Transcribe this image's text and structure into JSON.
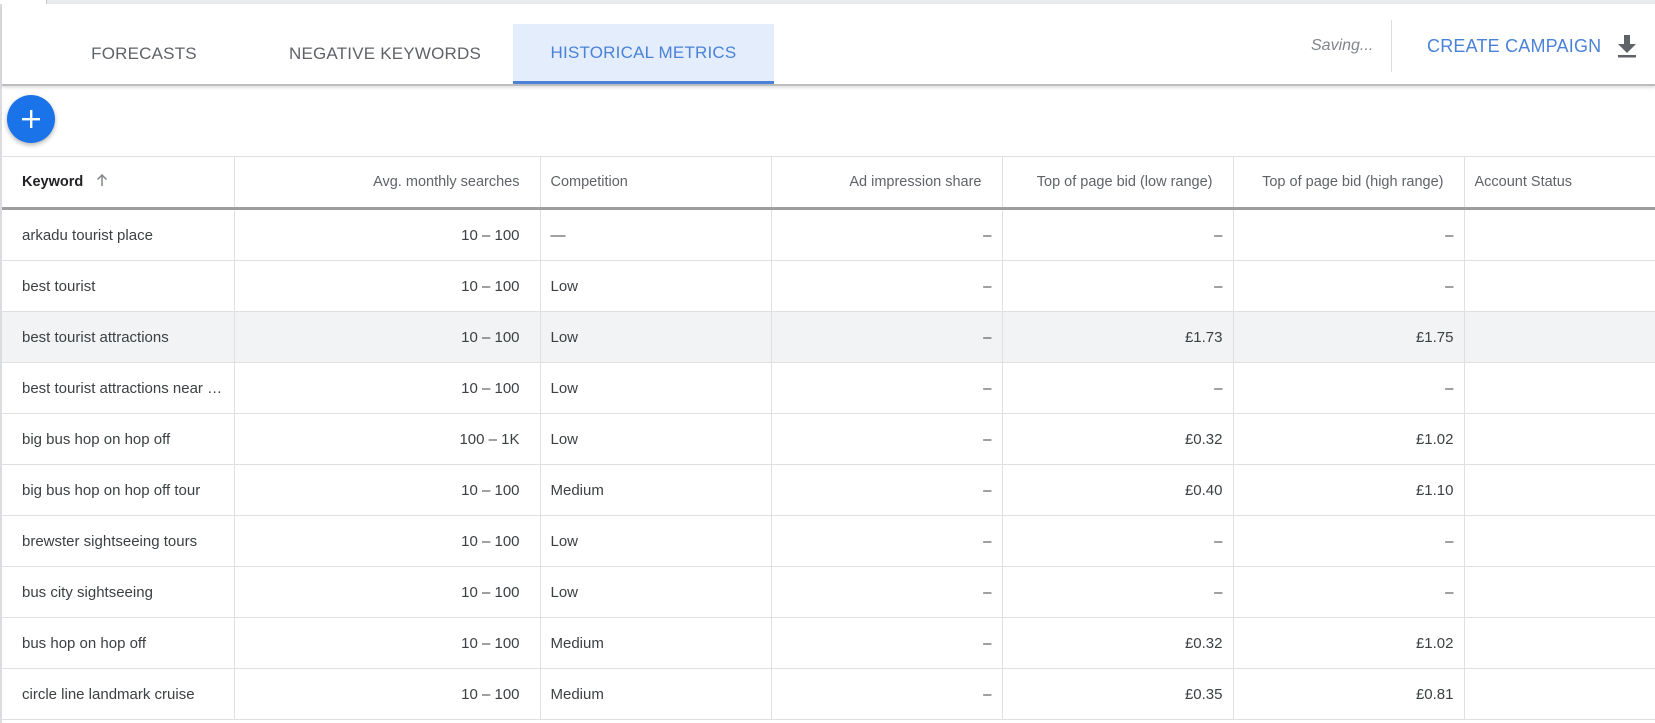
{
  "tabs": [
    {
      "label": "FORECASTS",
      "active": false
    },
    {
      "label": "NEGATIVE KEYWORDS",
      "active": false
    },
    {
      "label": "HISTORICAL METRICS",
      "active": true
    }
  ],
  "header": {
    "status_text": "Saving...",
    "create_campaign_label": "CREATE CAMPAIGN",
    "download_icon": "download-icon"
  },
  "fab": {
    "icon": "plus-icon"
  },
  "colors": {
    "accent": "#4a82d8",
    "fab": "#1a73e8",
    "active_tab_bg": "#e3edfb",
    "highlight_row": "#f1f3f4"
  },
  "table": {
    "columns": [
      {
        "label": "Keyword",
        "sort": "ascending"
      },
      {
        "label": "Avg. monthly searches"
      },
      {
        "label": "Competition"
      },
      {
        "label": "Ad impression share"
      },
      {
        "label": "Top of page bid (low range)"
      },
      {
        "label": "Top of page bid (high range)"
      },
      {
        "label": "Account Status"
      }
    ],
    "rows": [
      {
        "keyword": "arkadu tourist place",
        "searches": "10 – 100",
        "competition": "—",
        "impression_share": "–",
        "bid_low": "–",
        "bid_high": "–",
        "status": ""
      },
      {
        "keyword": "best tourist",
        "searches": "10 – 100",
        "competition": "Low",
        "impression_share": "–",
        "bid_low": "–",
        "bid_high": "–",
        "status": ""
      },
      {
        "keyword": "best tourist attractions",
        "searches": "10 – 100",
        "competition": "Low",
        "impression_share": "–",
        "bid_low": "£1.73",
        "bid_high": "£1.75",
        "status": "",
        "highlighted": true
      },
      {
        "keyword": "best tourist attractions near me",
        "searches": "10 – 100",
        "competition": "Low",
        "impression_share": "–",
        "bid_low": "–",
        "bid_high": "–",
        "status": ""
      },
      {
        "keyword": "big bus hop on hop off",
        "searches": "100 – 1K",
        "competition": "Low",
        "impression_share": "–",
        "bid_low": "£0.32",
        "bid_high": "£1.02",
        "status": ""
      },
      {
        "keyword": "big bus hop on hop off tour",
        "searches": "10 – 100",
        "competition": "Medium",
        "impression_share": "–",
        "bid_low": "£0.40",
        "bid_high": "£1.10",
        "status": ""
      },
      {
        "keyword": "brewster sightseeing tours",
        "searches": "10 – 100",
        "competition": "Low",
        "impression_share": "–",
        "bid_low": "–",
        "bid_high": "–",
        "status": ""
      },
      {
        "keyword": "bus city sightseeing",
        "searches": "10 – 100",
        "competition": "Low",
        "impression_share": "–",
        "bid_low": "–",
        "bid_high": "–",
        "status": ""
      },
      {
        "keyword": "bus hop on hop off",
        "searches": "10 – 100",
        "competition": "Medium",
        "impression_share": "–",
        "bid_low": "£0.32",
        "bid_high": "£1.02",
        "status": ""
      },
      {
        "keyword": "circle line landmark cruise",
        "searches": "10 – 100",
        "competition": "Medium",
        "impression_share": "–",
        "bid_low": "£0.35",
        "bid_high": "£0.81",
        "status": ""
      }
    ]
  }
}
